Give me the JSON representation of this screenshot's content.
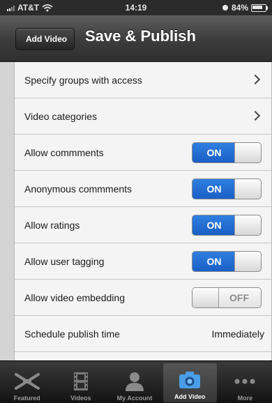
{
  "status_bar": {
    "carrier": "AT&T",
    "time": "14:19",
    "battery": "84%"
  },
  "nav": {
    "back_label": "Add Video",
    "title": "Save & Publish"
  },
  "settings": {
    "groups_access": {
      "label": "Specify groups with access"
    },
    "video_categories": {
      "label": "Video categories"
    },
    "allow_comments": {
      "label": "Allow commments",
      "state": "ON"
    },
    "anonymous_comments": {
      "label": "Anonymous commments",
      "state": "ON"
    },
    "allow_ratings": {
      "label": "Allow ratings",
      "state": "ON"
    },
    "allow_user_tagging": {
      "label": "Allow user tagging",
      "state": "ON"
    },
    "allow_video_embedding": {
      "label": "Allow video embedding",
      "state": "OFF"
    },
    "schedule_publish_time": {
      "label": "Schedule publish time",
      "value": "Immediately"
    }
  },
  "tab_bar": {
    "featured": {
      "label": "Featured",
      "icon": "featured-icon"
    },
    "videos": {
      "label": "Videos",
      "icon": "film-icon"
    },
    "my_account": {
      "label": "My Account",
      "icon": "person-icon"
    },
    "add_video": {
      "label": "Add Video",
      "icon": "camera-icon",
      "selected": true
    },
    "more": {
      "label": "More",
      "icon": "more-icon"
    }
  },
  "colors": {
    "toggle_on": "#1a5fc6",
    "nav_bar": "#3e3e3e",
    "tab_bar": "#121212"
  }
}
